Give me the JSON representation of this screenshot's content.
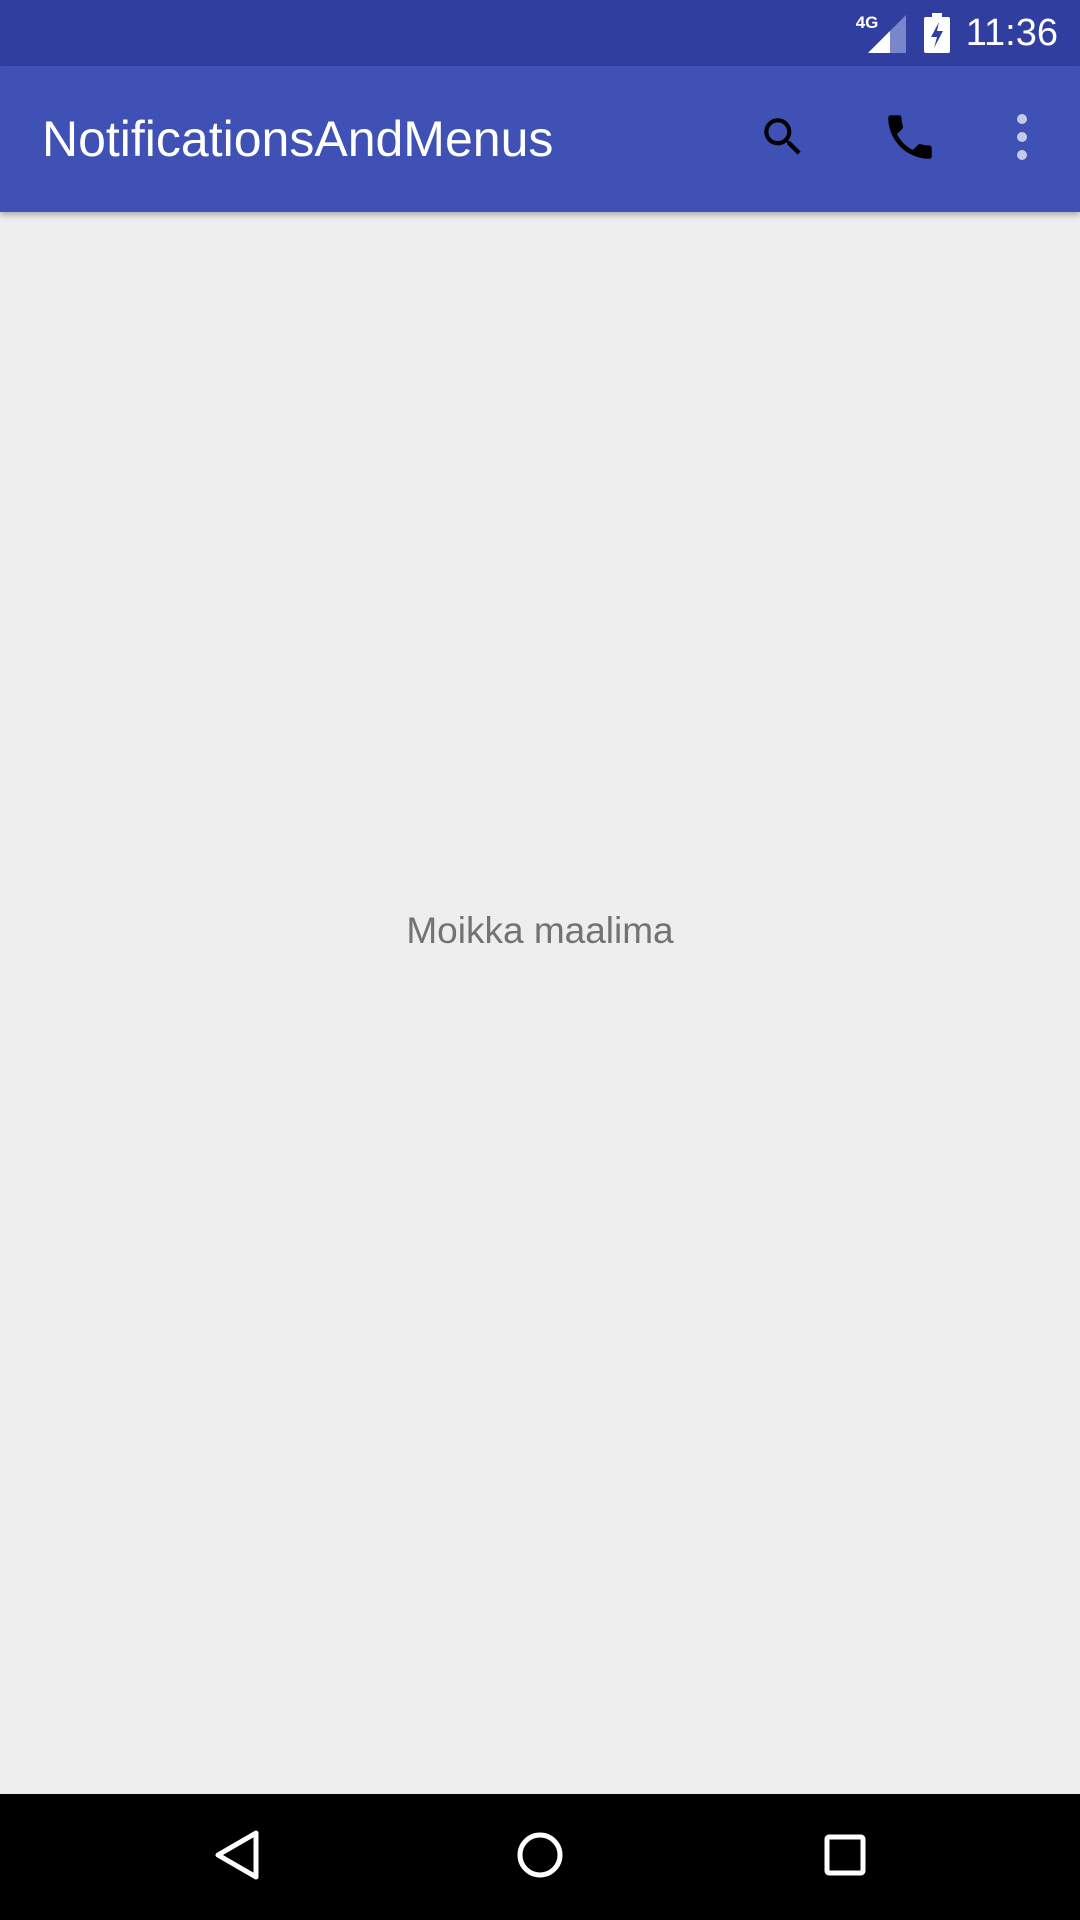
{
  "status_bar": {
    "network_label": "4G",
    "time": "11:36",
    "icons": [
      "signal-icon",
      "battery-charging-icon"
    ],
    "background": "#303F9F"
  },
  "app_bar": {
    "title": "NotificationsAndMenus",
    "background": "#3F51B5",
    "actions": [
      "search-icon",
      "phone-icon",
      "more-vert-icon"
    ]
  },
  "content": {
    "message": "Moikka maalima",
    "background": "#EEEEEE"
  },
  "nav_bar": {
    "buttons": [
      "back-icon",
      "home-icon",
      "recents-icon"
    ]
  }
}
